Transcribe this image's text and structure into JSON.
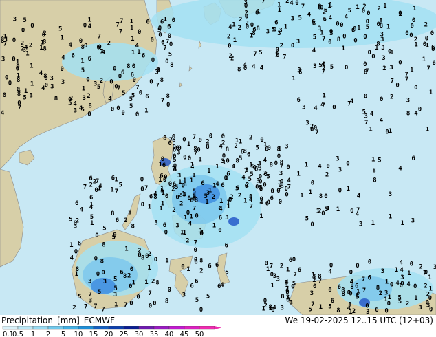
{
  "map": {
    "ocean_color": "#c8e8f4",
    "land_color": "#d7cfa8",
    "mountain_color": "#c9b88a",
    "shallow_precip_color": "#a3e0f2",
    "medium_precip_color": "#7cc8ec",
    "heavy_precip_color": "#3f8ee0",
    "very_heavy_precip_color": "#2659c8",
    "extreme_precip_color": "#6a23c8"
  },
  "legend": {
    "title": "Precipitation",
    "unit": "[mm]",
    "model": "ECMWF",
    "ticks": [
      "0.1",
      "0.5",
      "1",
      "2",
      "5",
      "10",
      "15",
      "20",
      "25",
      "30",
      "35",
      "40",
      "45",
      "50"
    ],
    "colors": [
      "#d9f1f9",
      "#bbe8f6",
      "#99dbf2",
      "#71c9ec",
      "#45b1e4",
      "#1f8fd8",
      "#1560c2",
      "#0d3fac",
      "#0b1e92",
      "#6e1ab0",
      "#9a1ac2",
      "#c21ad0",
      "#dc20c0",
      "#f02ab0"
    ]
  },
  "datetime": "We 19-02-2025 12..15 UTC (12+03)"
}
